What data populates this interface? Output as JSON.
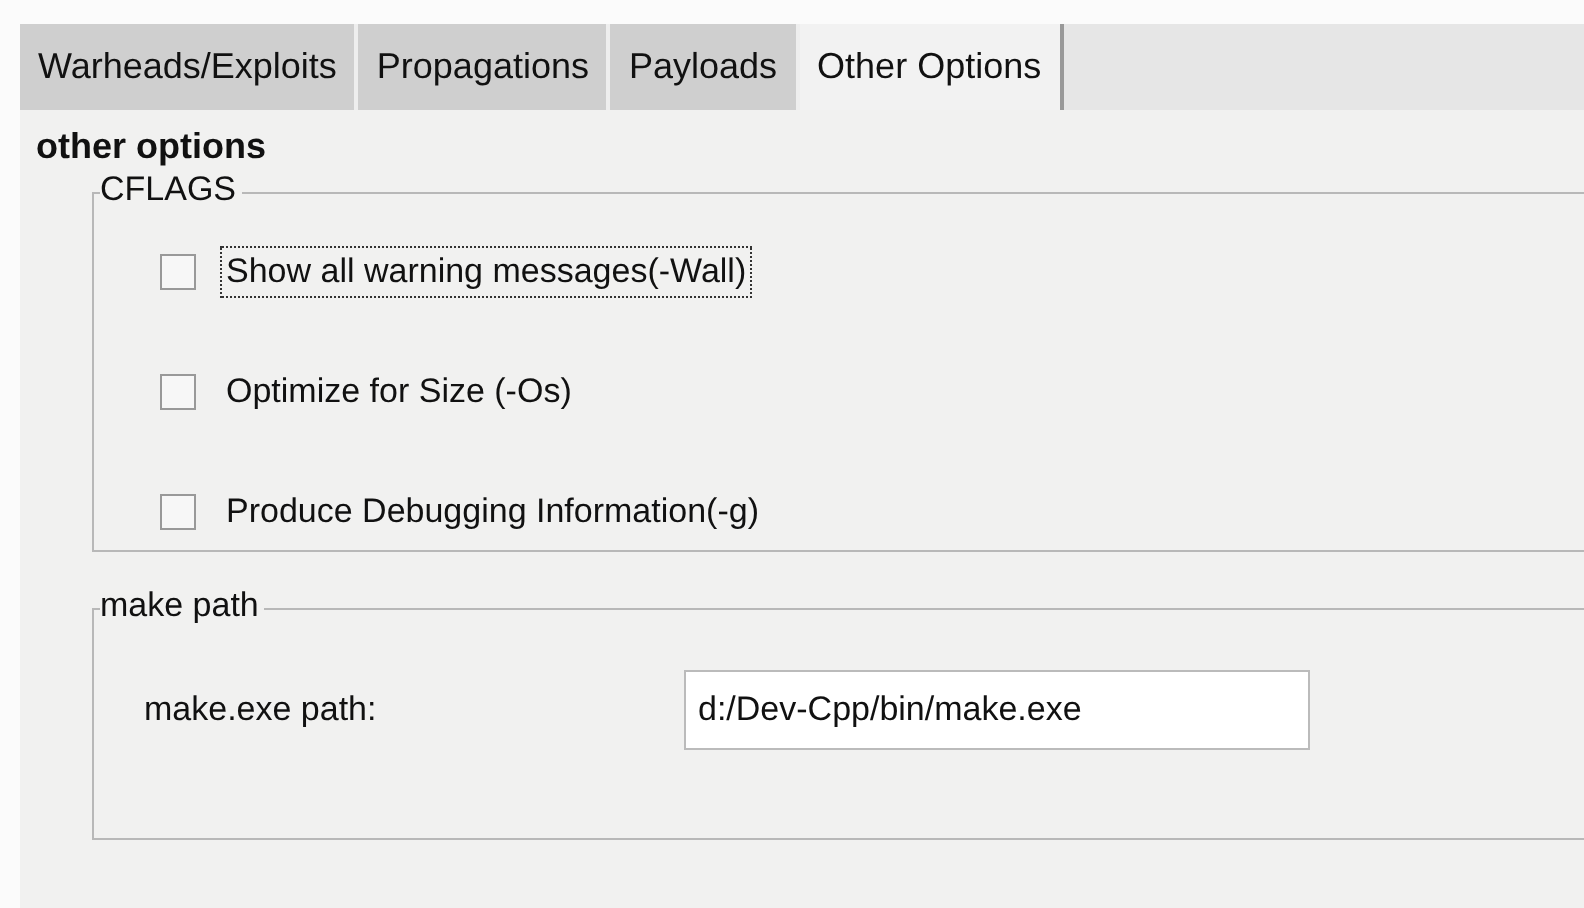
{
  "tabs": [
    {
      "label": "Warheads/Exploits",
      "selected": false
    },
    {
      "label": "Propagations",
      "selected": false
    },
    {
      "label": "Payloads",
      "selected": false
    },
    {
      "label": "Other Options",
      "selected": true
    }
  ],
  "heading": "other options",
  "cflags": {
    "legend": "CFLAGS",
    "options": [
      {
        "label": "Show all warning messages(-Wall)",
        "checked": false,
        "focused": true
      },
      {
        "label": "Optimize for Size (-Os)",
        "checked": false,
        "focused": false
      },
      {
        "label": "Produce Debugging Information(-g)",
        "checked": false,
        "focused": false
      }
    ]
  },
  "make_path": {
    "legend": "make path",
    "label": "make.exe path:",
    "value": "d:/Dev-Cpp/bin/make.exe"
  }
}
